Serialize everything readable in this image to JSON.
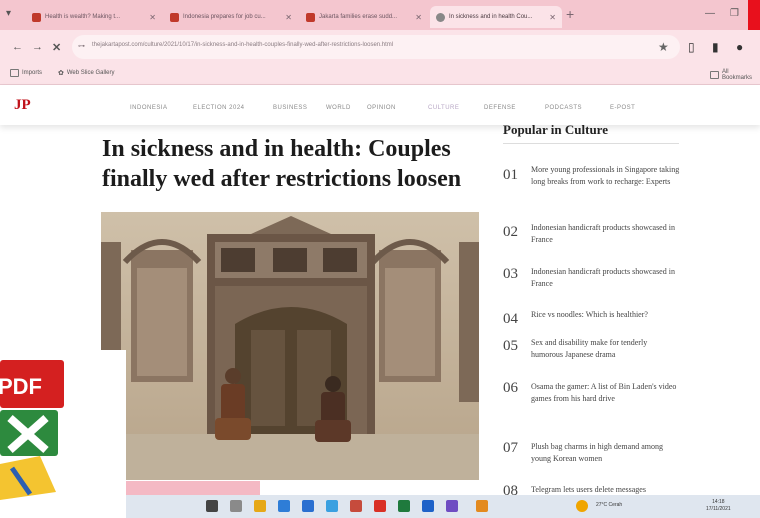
{
  "browser": {
    "tabs": [
      {
        "label": "Health is wealth? Making t..."
      },
      {
        "label": "Indonesia prepares for job cu..."
      },
      {
        "label": "Jakarta families erase sudd..."
      },
      {
        "label": "In sickness and in health Cou..."
      }
    ],
    "url": "thejakartapost.com/culture/2021/10/17/in-sickness-and-in-health-couples-finally-wed-after-restrictions-loosen.html",
    "bookmarks": [
      {
        "label": "Imports"
      },
      {
        "label": "Web Slice Gallery"
      }
    ],
    "bookmarks_right": "All Bookmarks",
    "accent_color": "#f4c6cf"
  },
  "site": {
    "logo": "JP",
    "nav": [
      "INDONESIA",
      "ELECTION 2024",
      "BUSINESS",
      "WORLD",
      "OPINION",
      "CULTURE",
      "DEFENSE",
      "PODCASTS",
      "E-POST"
    ]
  },
  "article": {
    "headline": "In sickness and in health: Couples finally wed after restrictions loosen"
  },
  "sidebar": {
    "title": "Popular in Culture",
    "items": [
      {
        "num": "01",
        "text": "More young professionals in Singapore taking long breaks from work to recharge: Experts"
      },
      {
        "num": "02",
        "text": "Indonesian handicraft products showcased in France"
      },
      {
        "num": "03",
        "text": "Indonesian handicraft products showcased in France"
      },
      {
        "num": "04",
        "text": "Rice vs noodles: Which is healthier?"
      },
      {
        "num": "05",
        "text": "Sex and disability make for tenderly humorous Japanese drama"
      },
      {
        "num": "06",
        "text": "Osama the gamer: A list of Bin Laden's video games from his hard drive"
      },
      {
        "num": "07",
        "text": "Plush bag charms in high demand among young Korean women"
      },
      {
        "num": "08",
        "text": "Telegram lets users delete messages"
      }
    ]
  },
  "desktop": {
    "pdf_label": "PDF",
    "weather": "27°C Cerah",
    "time": "14:18",
    "date": "17/11/2021"
  }
}
